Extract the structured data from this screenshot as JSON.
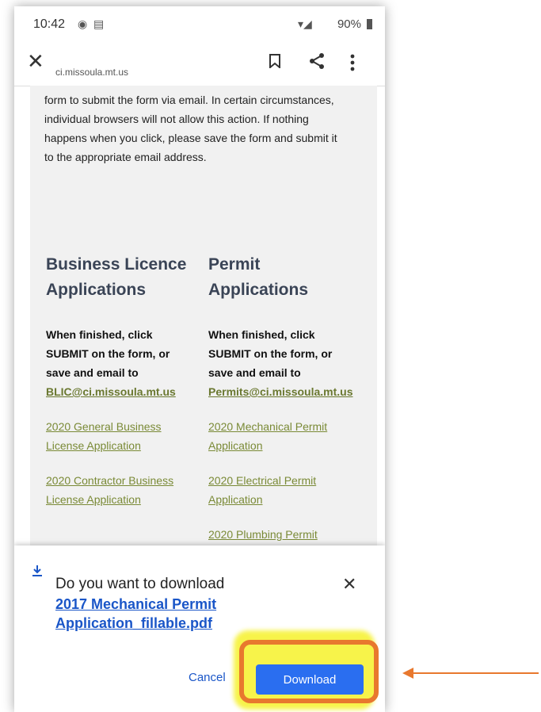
{
  "status_bar": {
    "time": "10:42",
    "battery": "90%"
  },
  "toolbar": {
    "url": "ci.missoula.mt.us"
  },
  "page": {
    "intro": "form to submit the form via email. In certain circumstances, individual browsers will not allow this action. If nothing happens when you click, please save the form and submit it to the appropriate email address.",
    "business": {
      "heading": "Business Licence Applications",
      "instructions": "When finished, click SUBMIT on the form, or save and email to",
      "email": "BLIC@ci.missoula.mt.us",
      "links": [
        "2020 General Business License Application",
        "2020 Contractor Business License Application"
      ]
    },
    "permit": {
      "heading": "Permit Applications",
      "instructions": "When finished, click SUBMIT on the form, or save and email to",
      "email": "Permits@ci.missoula.mt.us",
      "links": [
        "2020 Mechanical Permit Application",
        "2020 Electrical Permit Application",
        "2020 Plumbing Permit"
      ]
    }
  },
  "download_sheet": {
    "question": "Do you want to download",
    "filename": "2017 Mechanical Permit Application_fillable.pdf",
    "cancel_label": "Cancel",
    "download_label": "Download"
  },
  "colors": {
    "accent_blue": "#2a6ef0",
    "highlight_orange": "#e8782e",
    "highlight_yellow": "#f7f34a",
    "link_olive": "#7a8a36"
  }
}
